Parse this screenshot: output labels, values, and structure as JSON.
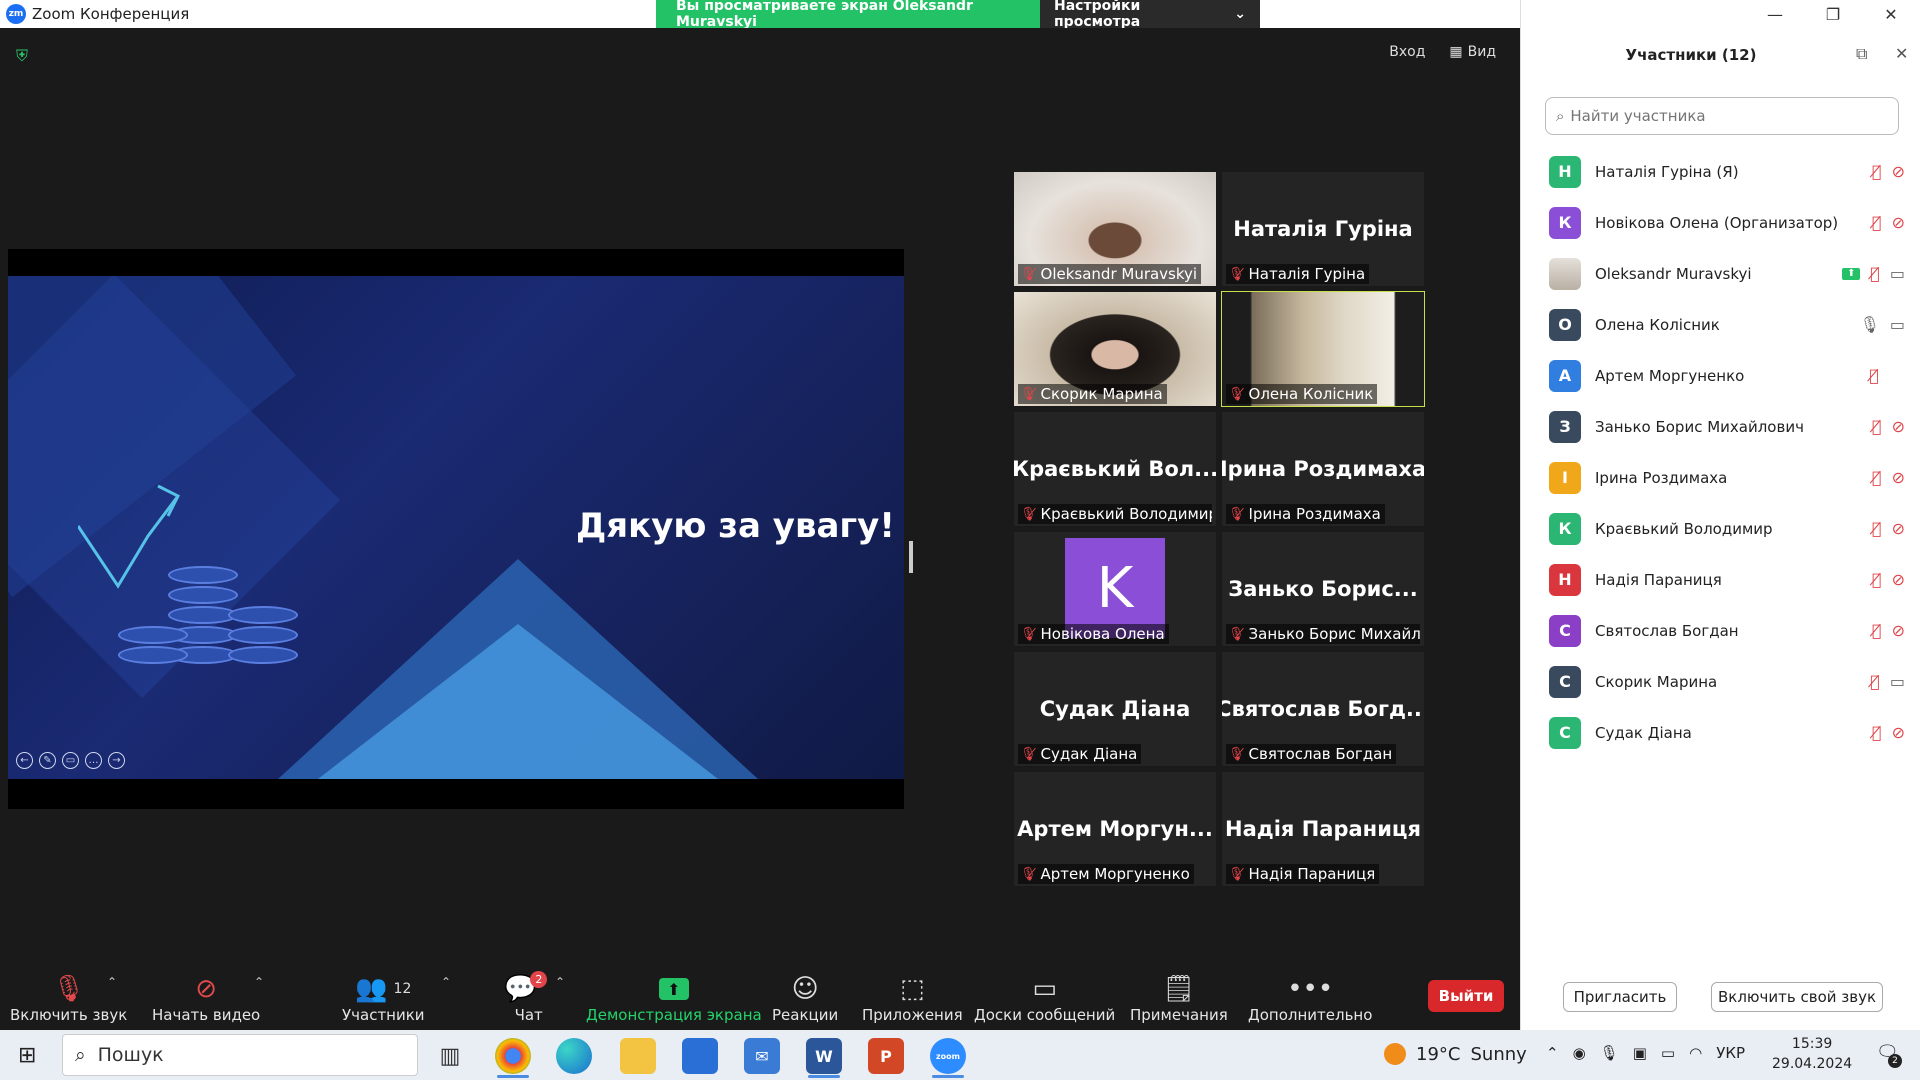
{
  "window": {
    "title": "Zoom Конференция",
    "logo": "zm"
  },
  "banner": {
    "viewing": "Вы просматриваете экран Oleksandr Muravskyi",
    "view_settings": "Настройки просмотра"
  },
  "topbar": {
    "enter": "Вход",
    "view": "Вид"
  },
  "slide": {
    "text": "Дякую за увагу!"
  },
  "gallery": [
    {
      "big": "",
      "name": "Oleksandr Muravskyi",
      "video": true
    },
    {
      "big": "Наталія Гуріна",
      "name": "Наталія Гуріна",
      "video": false
    },
    {
      "big": "",
      "name": "Скорик Марина",
      "video": true
    },
    {
      "big": "",
      "name": "Олена Колісник",
      "video": true,
      "active": true
    },
    {
      "big": "Краєвький Вол...",
      "name": "Краєвький Володимир",
      "video": false
    },
    {
      "big": "Ірина Роздимаха",
      "name": "Ірина Роздимаха",
      "video": false
    },
    {
      "big": "K",
      "name": "Новікова Олена",
      "video": false
    },
    {
      "big": "Занько Борис...",
      "name": "Занько Борис Михайл...",
      "video": false
    },
    {
      "big": "Судак Діана",
      "name": "Судак Діана",
      "video": false
    },
    {
      "big": "Святослав Богд...",
      "name": "Святослав Богдан",
      "video": false
    },
    {
      "big": "Артем Моргун...",
      "name": "Артем Моргуненко",
      "video": false
    },
    {
      "big": "Надія Параниця",
      "name": "Надія Параниця",
      "video": false
    }
  ],
  "toolbar": {
    "unmute": "Включить звук",
    "start_video": "Начать видео",
    "participants": "Участники",
    "participants_count": "12",
    "chat": "Чат",
    "chat_badge": "2",
    "share": "Демонстрация экрана",
    "reactions": "Реакции",
    "apps": "Приложения",
    "whiteboards": "Доски сообщений",
    "notes": "Примечания",
    "more": "Дополнительно",
    "leave": "Выйти"
  },
  "panel": {
    "title": "Участники (12)",
    "search_placeholder": "Найти участника",
    "invite": "Пригласить",
    "unmute_me": "Включить свой звук",
    "participants": [
      {
        "initial": "Н",
        "color": "#2bb673",
        "name": "Наталія Гуріна (Я)",
        "mic": "muted",
        "cam": "off"
      },
      {
        "initial": "К",
        "color": "#8a4fd6",
        "name": "Новікова Олена (Организатор)",
        "mic": "muted",
        "cam": "off"
      },
      {
        "initial": "",
        "color": "#c9c2b8",
        "name": "Oleksandr Muravskyi",
        "mic": "muted",
        "cam": "on",
        "sharing": true
      },
      {
        "initial": "О",
        "color": "#3a4a5e",
        "name": "Олена Колісник",
        "mic": "on",
        "cam": "on"
      },
      {
        "initial": "А",
        "color": "#2f7ee0",
        "name": "Артем Моргуненко",
        "mic": "muted",
        "cam": "none"
      },
      {
        "initial": "З",
        "color": "#3a4a5e",
        "name": "Занько Борис Михайлович",
        "mic": "muted",
        "cam": "off"
      },
      {
        "initial": "І",
        "color": "#f0a81a",
        "name": "Ірина Роздимаха",
        "mic": "muted",
        "cam": "off"
      },
      {
        "initial": "К",
        "color": "#2bb673",
        "name": "Краєвький Володимир",
        "mic": "muted",
        "cam": "off"
      },
      {
        "initial": "Н",
        "color": "#d9363e",
        "name": "Надія Параниця",
        "mic": "muted",
        "cam": "off"
      },
      {
        "initial": "С",
        "color": "#8a3fc6",
        "name": "Святослав Богдан",
        "mic": "muted",
        "cam": "off"
      },
      {
        "initial": "С",
        "color": "#3a4a5e",
        "name": "Скорик Марина",
        "mic": "muted",
        "cam": "on"
      },
      {
        "initial": "С",
        "color": "#2bb673",
        "name": "Судак Діана",
        "mic": "muted",
        "cam": "off"
      }
    ]
  },
  "taskbar": {
    "search": "Пошук",
    "weather_temp": "19°C",
    "weather_text": "Sunny",
    "lang": "УКР",
    "time": "15:39",
    "date": "29.04.2024",
    "notif_count": "2"
  }
}
